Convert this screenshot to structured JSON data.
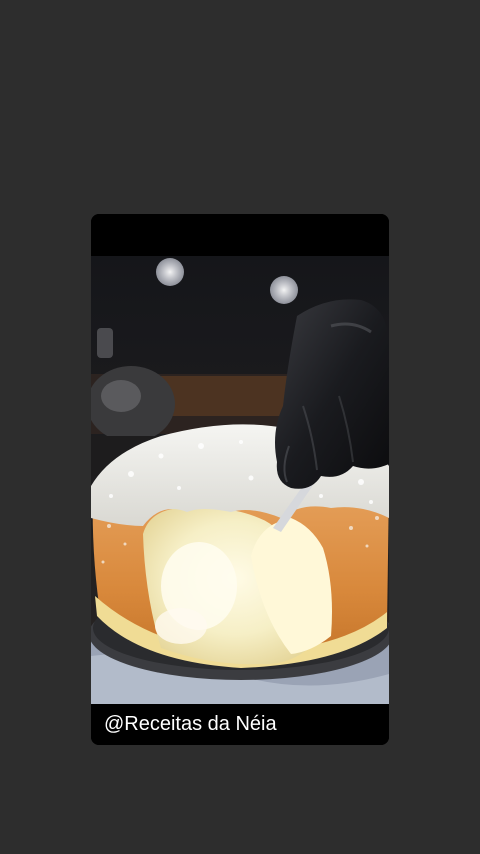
{
  "story": {
    "caption": "@Receitas da Néia",
    "background_color": "#2d2d2d",
    "media_description_icon": "cake-photo"
  }
}
